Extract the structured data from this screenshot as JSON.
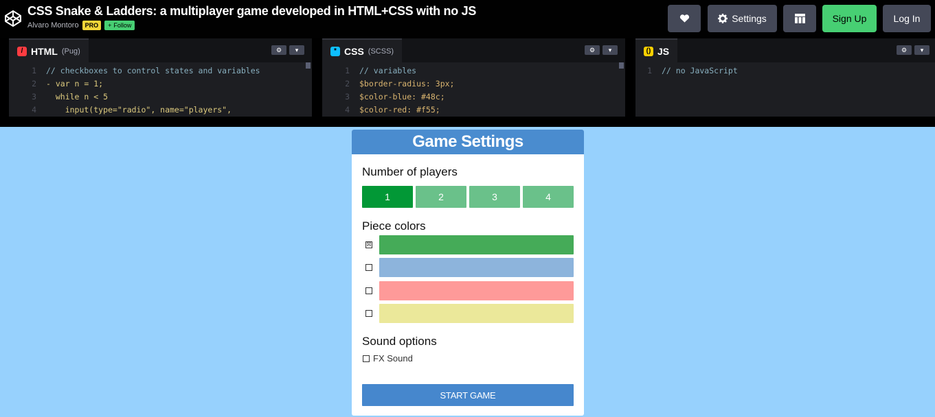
{
  "header": {
    "title": "CSS Snake & Ladders: a multiplayer game developed in HTML+CSS with no JS",
    "author": "Alvaro Montoro",
    "pro_badge": "PRO",
    "follow_label": "Follow",
    "settings_label": "Settings",
    "signup_label": "Sign Up",
    "login_label": "Log In"
  },
  "editors": {
    "html": {
      "name": "HTML",
      "sub": "(Pug)",
      "lines": [
        {
          "n": "1",
          "code": "// checkboxes to control states and variables"
        },
        {
          "n": "2",
          "code": "- var n = 1;"
        },
        {
          "n": "3",
          "code": "  while n < 5"
        },
        {
          "n": "4",
          "code": "    input(type=\"radio\", name=\"players\","
        }
      ]
    },
    "css": {
      "name": "CSS",
      "sub": "(SCSS)",
      "lines": [
        {
          "n": "1",
          "code": "// variables"
        },
        {
          "n": "2",
          "code": "$border-radius: 3px;"
        },
        {
          "n": "3",
          "code": "$color-blue: #48c;"
        },
        {
          "n": "4",
          "code": "$color-red: #f55;"
        }
      ]
    },
    "js": {
      "name": "JS",
      "sub": "",
      "lines": [
        {
          "n": "1",
          "code": "// no JavaScript"
        }
      ]
    }
  },
  "game": {
    "title": "Game Settings",
    "players_label": "Number of players",
    "players": [
      "1",
      "2",
      "3",
      "4"
    ],
    "selected_players": "1",
    "colors_label": "Piece colors",
    "piece_colors": [
      "#45ab58",
      "#8db4dc",
      "#fe9a99",
      "#ebe89a"
    ],
    "piece_checked": [
      true,
      false,
      false,
      false
    ],
    "sound_label": "Sound options",
    "fx_label": "FX Sound",
    "start_label": "START GAME"
  },
  "colors": {
    "background": "#97d1fd",
    "card_header": "#4a8ccf",
    "player_active": "#029836",
    "player_inactive": "#6ac18a",
    "start_button": "#4687cd",
    "signup": "#47cf73"
  }
}
